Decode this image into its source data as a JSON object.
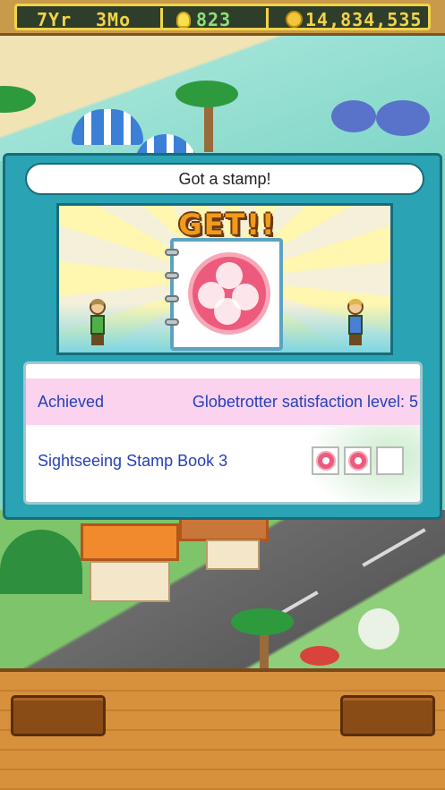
{
  "status_bar": {
    "year": "7Yr",
    "month": "3Mo",
    "research_points": "823",
    "money": "14,834,535",
    "icons": {
      "research": "lightbulb-icon",
      "money": "gold-coin-icon"
    }
  },
  "dialog": {
    "title": "Got a stamp!",
    "banner": "GET!!",
    "stamp_icon": "hibiscus-stamp-icon",
    "achieved_label": "Achieved",
    "achieved_value": "Globetrotter satisfaction level: 5",
    "book_label": "Sightseeing Stamp Book 3",
    "stamp_slots": [
      {
        "filled": true
      },
      {
        "filled": true
      },
      {
        "filled": false
      }
    ]
  },
  "colors": {
    "dialog_frame": "#2aa3b5",
    "text_blue": "#2640b8",
    "highlight_pink": "#fbd3ef",
    "stamp_pink": "#ee5a7c",
    "wood": "#d7903c"
  }
}
